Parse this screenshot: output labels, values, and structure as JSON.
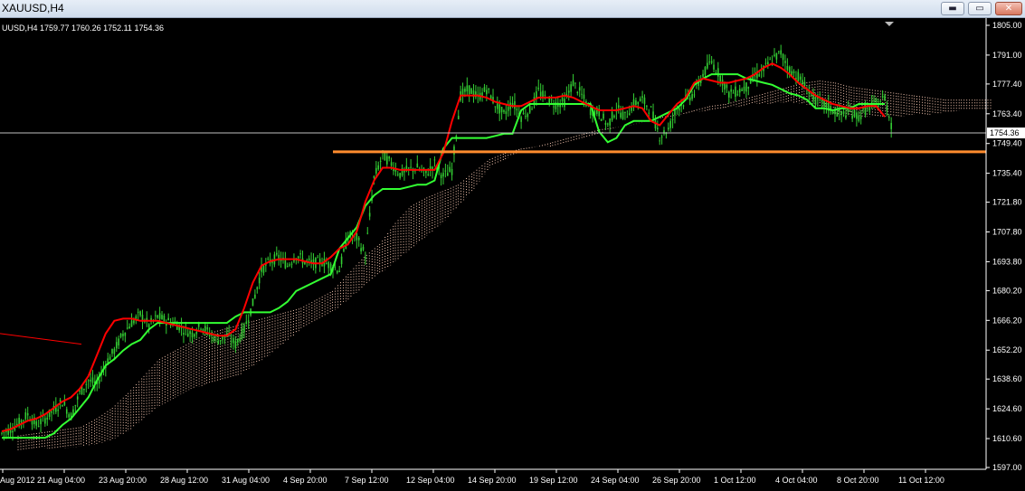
{
  "window": {
    "title": "XAUUSD,H4",
    "buttons": {
      "minimize": "▬",
      "maximize": "▭",
      "close": "✕"
    }
  },
  "colors": {
    "background": "#000000",
    "candles": "#33cc33",
    "tenkan": "#ff0000",
    "kijun": "#33ff33",
    "cloud": "#f5c6b0",
    "support_line": "#ff8c2e",
    "price_line": "#c0c0c0",
    "axis_text": "#ffffff"
  },
  "chart_data": {
    "type": "line",
    "symbol": "XAUUSD,H4",
    "ohlc_label": "UUSD,H4  1759.77 1760.26 1752.11 1754.36",
    "current_price": "1754.36",
    "ylim": [
      1597.0,
      1805.0
    ],
    "y_ticks": [
      "1805.00",
      "1791.00",
      "1777.40",
      "1763.40",
      "1749.40",
      "1735.40",
      "1721.80",
      "1707.80",
      "1693.80",
      "1680.20",
      "1666.20",
      "1652.20",
      "1638.60",
      "1624.60",
      "1610.60",
      "1597.00"
    ],
    "x_ticks": [
      "Aug 2012",
      "21 Aug 04:00",
      "23 Aug 20:00",
      "28 Aug 12:00",
      "31 Aug 04:00",
      "4 Sep 20:00",
      "7 Sep 12:00",
      "12 Sep 04:00",
      "14 Sep 20:00",
      "19 Sep 12:00",
      "24 Sep 04:00",
      "26 Sep 20:00",
      "1 Oct 12:00",
      "4 Oct 04:00",
      "8 Oct 20:00",
      "11 Oct 12:00"
    ],
    "horizontal_line": 1745.5,
    "close_series": [
      1615,
      1618,
      1622,
      1617,
      1620,
      1624,
      1628,
      1621,
      1632,
      1638,
      1636,
      1646,
      1652,
      1660,
      1665,
      1669,
      1664,
      1668,
      1666,
      1665,
      1662,
      1660,
      1664,
      1660,
      1657,
      1659,
      1655,
      1662,
      1674,
      1690,
      1694,
      1696,
      1692,
      1697,
      1694,
      1693,
      1694,
      1692,
      1690,
      1706,
      1705,
      1697,
      1733,
      1744,
      1740,
      1735,
      1737,
      1738,
      1735,
      1740,
      1734,
      1737,
      1772,
      1775,
      1771,
      1775,
      1768,
      1763,
      1769,
      1762,
      1765,
      1774,
      1770,
      1768,
      1769,
      1778,
      1772,
      1765,
      1764,
      1758,
      1766,
      1762,
      1768,
      1770,
      1765,
      1753,
      1756,
      1766,
      1770,
      1773,
      1782,
      1788,
      1781,
      1773,
      1774,
      1776,
      1781,
      1784,
      1789,
      1792,
      1784,
      1781,
      1775,
      1770,
      1768,
      1765,
      1763,
      1764,
      1762,
      1766,
      1768,
      1771,
      1754
    ],
    "tenkan_series": [
      1614,
      1615,
      1617,
      1619,
      1620,
      1622,
      1625,
      1628,
      1630,
      1634,
      1640,
      1650,
      1660,
      1666,
      1667,
      1667,
      1666,
      1666,
      1666,
      1665,
      1664,
      1663,
      1662,
      1661,
      1660,
      1659,
      1659,
      1662,
      1672,
      1684,
      1692,
      1694,
      1695,
      1695,
      1695,
      1694,
      1693,
      1693,
      1696,
      1700,
      1702,
      1708,
      1722,
      1732,
      1738,
      1738,
      1737,
      1737,
      1737,
      1737,
      1737,
      1745,
      1760,
      1772,
      1772,
      1772,
      1771,
      1769,
      1768,
      1767,
      1767,
      1769,
      1771,
      1771,
      1771,
      1772,
      1771,
      1769,
      1767,
      1765,
      1765,
      1765,
      1766,
      1767,
      1766,
      1760,
      1758,
      1763,
      1768,
      1771,
      1778,
      1780,
      1779,
      1778,
      1778,
      1779,
      1780,
      1782,
      1785,
      1787,
      1785,
      1782,
      1778,
      1775,
      1772,
      1770,
      1768,
      1767,
      1766,
      1766,
      1767,
      1767,
      1762
    ],
    "kijun_series": [
      1611,
      1611,
      1611,
      1611,
      1611,
      1611,
      1613,
      1617,
      1620,
      1625,
      1630,
      1638,
      1645,
      1648,
      1652,
      1655,
      1657,
      1662,
      1665,
      1665,
      1665,
      1665,
      1665,
      1665,
      1665,
      1665,
      1665,
      1668,
      1670,
      1670,
      1670,
      1670,
      1672,
      1675,
      1680,
      1682,
      1684,
      1686,
      1688,
      1700,
      1705,
      1710,
      1720,
      1725,
      1728,
      1728,
      1728,
      1729,
      1730,
      1730,
      1732,
      1747,
      1752,
      1752,
      1752,
      1752,
      1752,
      1753,
      1754,
      1754,
      1765,
      1768,
      1768,
      1768,
      1768,
      1768,
      1768,
      1768,
      1768,
      1755,
      1750,
      1752,
      1758,
      1760,
      1760,
      1760,
      1762,
      1764,
      1766,
      1770,
      1777,
      1780,
      1782,
      1782,
      1782,
      1782,
      1780,
      1779,
      1778,
      1777,
      1775,
      1773,
      1772,
      1770,
      1766,
      1766,
      1765,
      1766,
      1766,
      1768,
      1768,
      1768,
      1768
    ],
    "cloud_upper": [
      1612,
      1613,
      1614,
      1615,
      1616,
      1620,
      1625,
      1632,
      1640,
      1648,
      1652,
      1656,
      1660,
      1662,
      1664,
      1666,
      1668,
      1670,
      1672,
      1676,
      1680,
      1688,
      1696,
      1702,
      1712,
      1720,
      1724,
      1727,
      1730,
      1736,
      1742,
      1745,
      1747,
      1748,
      1748,
      1750,
      1752,
      1754,
      1757,
      1758,
      1760,
      1761,
      1763,
      1765,
      1767,
      1768,
      1770,
      1772,
      1774,
      1776,
      1778,
      1779,
      1778,
      1776,
      1775,
      1774,
      1773,
      1772,
      1771,
      1770,
      1770,
      1770
    ],
    "cloud_lower": [
      1605,
      1606,
      1606,
      1606,
      1607,
      1608,
      1610,
      1614,
      1620,
      1626,
      1630,
      1634,
      1636,
      1638,
      1640,
      1645,
      1650,
      1656,
      1662,
      1666,
      1670,
      1676,
      1682,
      1688,
      1694,
      1700,
      1706,
      1712,
      1720,
      1728,
      1738,
      1742,
      1746,
      1748,
      1750,
      1752,
      1754,
      1756,
      1757,
      1758,
      1760,
      1762,
      1763,
      1764,
      1765,
      1766,
      1767,
      1768,
      1768,
      1769,
      1768,
      1766,
      1763,
      1762,
      1762,
      1762,
      1762,
      1763,
      1763,
      1764,
      1765,
      1765
    ],
    "legacy_red_line": {
      "from": 1660,
      "to": 1655
    }
  }
}
